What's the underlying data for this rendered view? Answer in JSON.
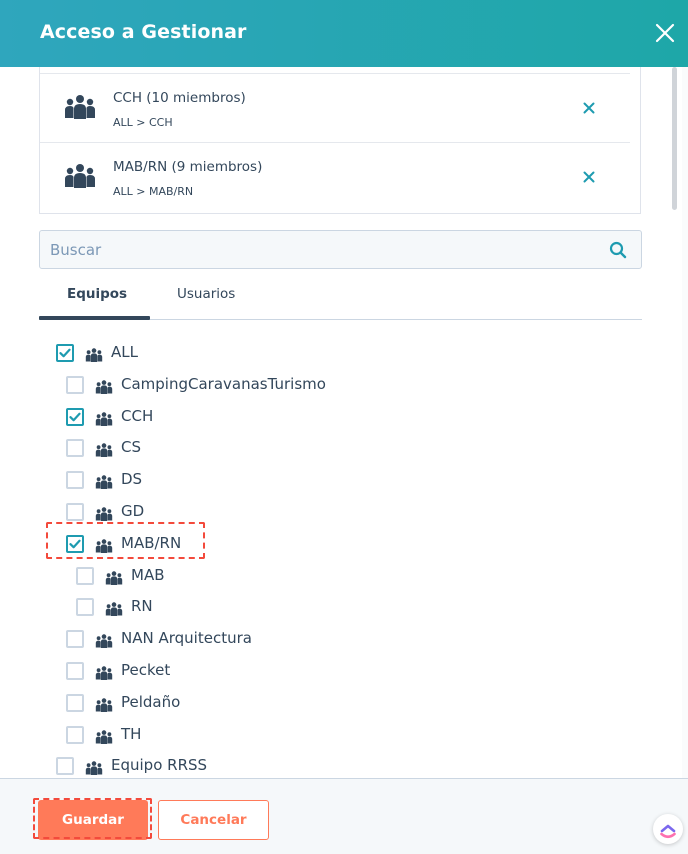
{
  "header": {
    "title": "Acceso a Gestionar"
  },
  "selected": [
    {
      "name": "CCH (10 miembros)",
      "path": "ALL > CCH"
    },
    {
      "name": "MAB/RN (9 miembros)",
      "path": "ALL > MAB/RN"
    }
  ],
  "search": {
    "placeholder": "Buscar",
    "value": ""
  },
  "tabs": [
    {
      "label": "Equipos",
      "active": true
    },
    {
      "label": "Usuarios",
      "active": false
    }
  ],
  "tree": [
    {
      "label": "ALL",
      "checked": true,
      "level": 0
    },
    {
      "label": "CampingCaravanasTurismo",
      "checked": false,
      "level": 1
    },
    {
      "label": "CCH",
      "checked": true,
      "level": 1
    },
    {
      "label": "CS",
      "checked": false,
      "level": 1
    },
    {
      "label": "DS",
      "checked": false,
      "level": 1
    },
    {
      "label": "GD",
      "checked": false,
      "level": 1
    },
    {
      "label": "MAB/RN",
      "checked": true,
      "level": 1
    },
    {
      "label": "MAB",
      "checked": false,
      "level": 2
    },
    {
      "label": "RN",
      "checked": false,
      "level": 2
    },
    {
      "label": "NAN Arquitectura",
      "checked": false,
      "level": 1
    },
    {
      "label": "Pecket",
      "checked": false,
      "level": 1
    },
    {
      "label": "Peldaño",
      "checked": false,
      "level": 1
    },
    {
      "label": "TH",
      "checked": false,
      "level": 1
    },
    {
      "label": "Equipo RRSS",
      "checked": false,
      "level": 0
    }
  ],
  "footer": {
    "save_label": "Guardar",
    "cancel_label": "Cancelar"
  },
  "colors": {
    "header": "#1ea7a8",
    "accent": "#1e9bb0",
    "primary_button": "#ff7a59",
    "highlight": "#f34a3c"
  },
  "icons": {
    "close": "close-icon",
    "team": "team-icon",
    "remove": "remove-x-icon",
    "search": "search-icon",
    "check": "checkmark-icon"
  }
}
